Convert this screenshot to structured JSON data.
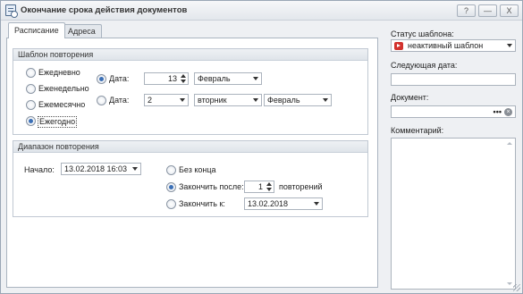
{
  "window": {
    "title": "Окончание срока действия документов",
    "buttons": {
      "help": "?",
      "minimize": "—",
      "close": "X"
    }
  },
  "tabs": [
    {
      "label": "Расписание",
      "active": true
    },
    {
      "label": "Адреса",
      "active": false
    }
  ],
  "repeat_pattern": {
    "header": "Шаблон повторения",
    "options": [
      {
        "label": "Ежедневно",
        "checked": false
      },
      {
        "label": "Еженедельно",
        "checked": false
      },
      {
        "label": "Ежемесячно",
        "checked": false
      },
      {
        "label": "Ежегодно",
        "checked": true
      }
    ],
    "date_row1": {
      "label": "Дата:",
      "checked": true,
      "day": "13",
      "month": "Февраль"
    },
    "date_row2": {
      "label": "Дата:",
      "checked": false,
      "week": "2",
      "weekday": "вторник",
      "month": "Февраль"
    }
  },
  "repeat_range": {
    "header": "Диапазон повторения",
    "start_label": "Начало:",
    "start_value": "13.02.2018 16:03",
    "no_end_label": "Без конца",
    "end_after_label": "Закончить после:",
    "end_after_value": "1",
    "end_after_suffix": "повторений",
    "end_by_label": "Закончить к:",
    "end_by_value": "13.02.2018",
    "selected": "end_after"
  },
  "side": {
    "status_label": "Статус шаблона:",
    "status_value": "неактивный шаблон",
    "status_color": "#d2322d",
    "next_date_label": "Следующая дата:",
    "next_date_value": "",
    "document_label": "Документ:",
    "document_value": "",
    "document_ellipsis": "•••",
    "comment_label": "Комментарий:",
    "comment_value": ""
  }
}
